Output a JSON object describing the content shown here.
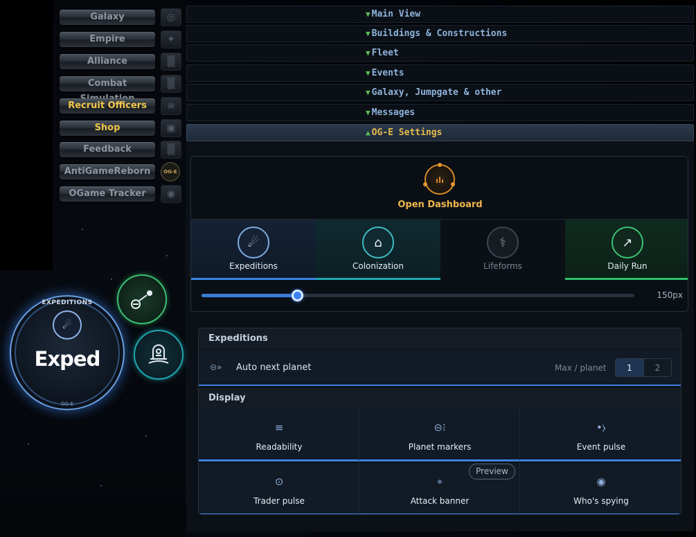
{
  "menu": {
    "items": [
      {
        "label": "Galaxy",
        "highlight": false,
        "icon": "galaxy-icon"
      },
      {
        "label": "Empire",
        "highlight": false,
        "icon": "empire-icon"
      },
      {
        "label": "Alliance",
        "highlight": false,
        "icon": "alliance-icon"
      },
      {
        "label": "Combat Simulation",
        "highlight": false,
        "icon": "simulation-icon"
      },
      {
        "label": "Recruit Officers",
        "highlight": true,
        "icon": "officers-icon"
      },
      {
        "label": "Shop",
        "highlight": true,
        "icon": "shop-icon"
      },
      {
        "label": "Feedback",
        "highlight": false,
        "icon": "feedback-icon"
      },
      {
        "label": "AntiGameReborn",
        "highlight": false,
        "icon": "og-e-icon"
      },
      {
        "label": "OGame Tracker",
        "highlight": false,
        "icon": "tracker-icon"
      }
    ],
    "og_badge": "OG-E"
  },
  "accordion": [
    {
      "label": "Main View",
      "open": false
    },
    {
      "label": "Buildings & Constructions",
      "open": false
    },
    {
      "label": "Fleet",
      "open": false
    },
    {
      "label": "Events",
      "open": false
    },
    {
      "label": "Galaxy, Jumpgate & other",
      "open": false
    },
    {
      "label": "Messages",
      "open": false
    },
    {
      "label": "OG-E Settings",
      "open": true
    }
  ],
  "dashboard": {
    "button_label": "Open Dashboard",
    "icon": "dashboard-icon",
    "accent": "#e8a43a"
  },
  "modes": [
    {
      "label": "Expeditions",
      "icon": "expedition-icon",
      "active": true,
      "color": "#3d83e0"
    },
    {
      "label": "Colonization",
      "icon": "colonization-icon",
      "active": true,
      "color": "#1fa7b0"
    },
    {
      "label": "Lifeforms",
      "icon": "lifeforms-icon",
      "active": false,
      "color": "#3a424c"
    },
    {
      "label": "Daily Run",
      "icon": "daily-run-icon",
      "active": true,
      "color": "#2fbf6a"
    }
  ],
  "slider": {
    "value_label": "150px",
    "fraction": 0.22
  },
  "expeditions_section": {
    "title": "Expeditions",
    "option_label": "Auto next planet",
    "max_label": "Max / planet",
    "choices": [
      "1",
      "2"
    ],
    "selected": "1"
  },
  "display_section": {
    "title": "Display",
    "items": [
      {
        "label": "Readability",
        "icon": "readability-icon"
      },
      {
        "label": "Planet markers",
        "icon": "planet-markers-icon"
      },
      {
        "label": "Event pulse",
        "icon": "event-pulse-icon"
      },
      {
        "label": "Trader pulse",
        "icon": "trader-pulse-icon"
      },
      {
        "label": "Attack banner",
        "icon": "attack-banner-icon"
      },
      {
        "label": "Who's spying",
        "icon": "eye-icon"
      }
    ],
    "preview_label": "Preview"
  },
  "widget": {
    "top_label": "EXPEDITIONS",
    "main_label": "Exped",
    "bottom_label": "OG-E"
  }
}
